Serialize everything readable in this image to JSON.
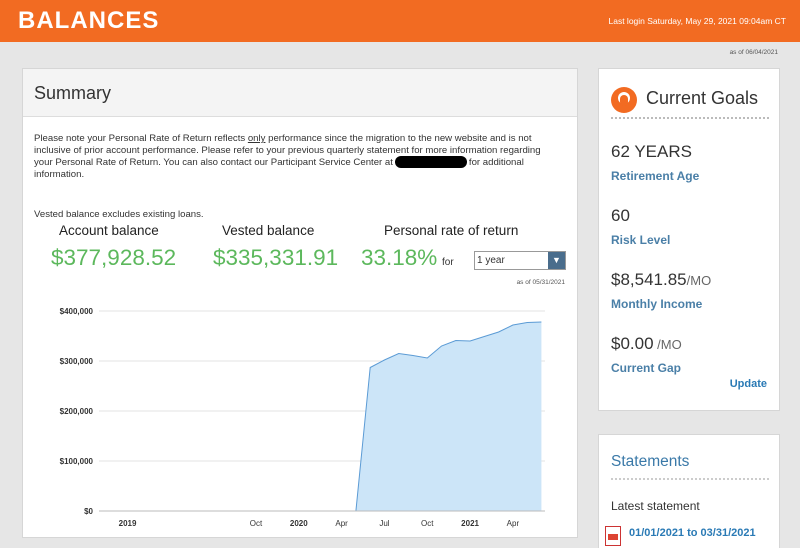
{
  "header": {
    "title": "BALANCES",
    "last_login": "Last login Saturday, May 29, 2021 09:04am CT"
  },
  "as_of_top": "as of 06/04/2021",
  "summary": {
    "title": "Summary",
    "note_before_underline": "Please note your Personal Rate of Return reflects ",
    "note_underline": "only",
    "note_after_underline": " performance since the migration to the new website and is not inclusive of prior account performance.  Please refer to your previous quarterly statement for more information regarding your Personal Rate of Return.  You can also contact our Participant Service Center at",
    "note_end": "for additional information.",
    "vested_note": "Vested balance excludes existing loans.",
    "account_balance_label": "Account balance",
    "account_balance_value": "$377,928.52",
    "vested_balance_label": "Vested balance",
    "vested_balance_value": "$335,331.91",
    "rate_label": "Personal rate of return",
    "rate_value": "33.18%",
    "for_label": "for",
    "period_select_value": "1 year",
    "chart_as_of": "as of 05/31/2021"
  },
  "chart_data": {
    "type": "area",
    "title": "",
    "xlabel": "",
    "ylabel": "",
    "ylim": [
      0,
      400000
    ],
    "y_ticks": [
      0,
      100000,
      200000,
      300000,
      400000
    ],
    "y_tick_labels": [
      "$0",
      "$100,000",
      "$200,000",
      "$300,000",
      "$400,000"
    ],
    "x_tick_labels": [
      {
        "label": "2019",
        "x": "2019-01",
        "bold": true
      },
      {
        "label": "Oct",
        "x": "2019-10",
        "bold": false
      },
      {
        "label": "2020",
        "x": "2020-01",
        "bold": true
      },
      {
        "label": "Apr",
        "x": "2020-04",
        "bold": false
      },
      {
        "label": "Jul",
        "x": "2020-07",
        "bold": false
      },
      {
        "label": "Oct",
        "x": "2020-10",
        "bold": false
      },
      {
        "label": "2021",
        "x": "2021-01",
        "bold": true
      },
      {
        "label": "Apr",
        "x": "2021-04",
        "bold": false
      }
    ],
    "grid": true,
    "fill_color": "#cce5f8",
    "line_color": "#5b9bd5",
    "series": [
      {
        "points": [
          [
            "2018-12",
            0
          ],
          [
            "2019-06",
            0
          ],
          [
            "2020-01",
            0
          ],
          [
            "2020-05",
            0
          ],
          [
            "2020-06",
            287000
          ],
          [
            "2020-07",
            302000
          ],
          [
            "2020-08",
            315000
          ],
          [
            "2020-09",
            311000
          ],
          [
            "2020-10",
            306000
          ],
          [
            "2020-11",
            330000
          ],
          [
            "2020-12",
            341000
          ],
          [
            "2021-01",
            340000
          ],
          [
            "2021-02",
            349000
          ],
          [
            "2021-03",
            358000
          ],
          [
            "2021-04",
            372000
          ],
          [
            "2021-05",
            377000
          ],
          [
            "2021-06",
            378000
          ]
        ]
      }
    ]
  },
  "goals": {
    "title": "Current Goals",
    "icon": "person-head-icon",
    "retirement_age_value": "62 YEARS",
    "retirement_age_label": "Retirement Age",
    "risk_level_value": "60",
    "risk_level_label": "Risk Level",
    "monthly_income_value": "$8,541.85",
    "monthly_income_unit": "/MO",
    "monthly_income_label": "Monthly Income",
    "current_gap_value": "$0.00",
    "current_gap_unit": " /MO",
    "current_gap_label": "Current Gap",
    "update_label": "Update"
  },
  "statements": {
    "title": "Statements",
    "latest_label": "Latest statement",
    "latest_link": "01/01/2021 to 03/31/2021",
    "icon": "pdf-icon"
  },
  "colors": {
    "brand_orange": "#f26b22",
    "balance_green": "#5cb85c",
    "link_blue": "#2a7ab5"
  }
}
